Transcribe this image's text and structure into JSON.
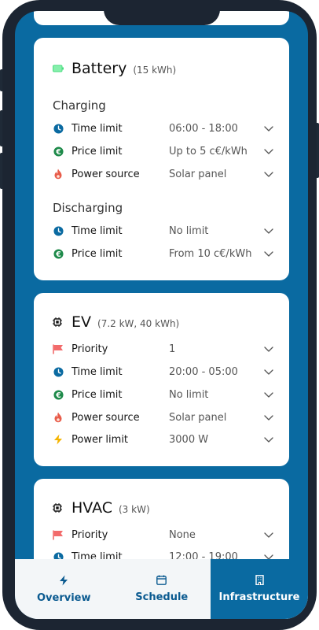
{
  "colors": {
    "accent": "#0A6AA1",
    "clock": "#0A6AA1",
    "euro": "#1E8A4A",
    "flame": "#E85C4A",
    "flag": "#F26B6B",
    "bolt": "#F5B400",
    "battery": "#4ADE80"
  },
  "cards": {
    "battery": {
      "title": "Battery",
      "subtitle": "(15 kWh)",
      "charging": {
        "heading": "Charging",
        "rows": [
          {
            "icon": "clock-icon",
            "label": "Time limit",
            "value": "06:00 - 18:00"
          },
          {
            "icon": "euro-icon",
            "label": "Price limit",
            "value": "Up to 5 c€/kWh"
          },
          {
            "icon": "flame-icon",
            "label": "Power source",
            "value": "Solar panel"
          }
        ]
      },
      "discharging": {
        "heading": "Discharging",
        "rows": [
          {
            "icon": "clock-icon",
            "label": "Time limit",
            "value": "No limit"
          },
          {
            "icon": "euro-icon",
            "label": "Price limit",
            "value": "From 10 c€/kWh"
          }
        ]
      }
    },
    "ev": {
      "title": "EV",
      "subtitle": "(7.2 kW, 40 kWh)",
      "rows": [
        {
          "icon": "flag-icon",
          "label": "Priority",
          "value": "1"
        },
        {
          "icon": "clock-icon",
          "label": "Time limit",
          "value": "20:00 - 05:00"
        },
        {
          "icon": "euro-icon",
          "label": "Price limit",
          "value": "No limit"
        },
        {
          "icon": "flame-icon",
          "label": "Power source",
          "value": "Solar panel"
        },
        {
          "icon": "bolt-icon",
          "label": "Power limit",
          "value": "3000 W"
        }
      ]
    },
    "hvac": {
      "title": "HVAC",
      "subtitle": "(3 kW)",
      "rows": [
        {
          "icon": "flag-icon",
          "label": "Priority",
          "value": "None"
        },
        {
          "icon": "clock-icon",
          "label": "Time limit",
          "value": "12:00 - 19:00"
        }
      ]
    }
  },
  "nav": {
    "overview": {
      "label": "Overview",
      "icon": "bolt-icon"
    },
    "schedule": {
      "label": "Schedule",
      "icon": "calendar-icon"
    },
    "infrastructure": {
      "label": "Infrastructure",
      "icon": "building-icon",
      "active": true
    }
  }
}
